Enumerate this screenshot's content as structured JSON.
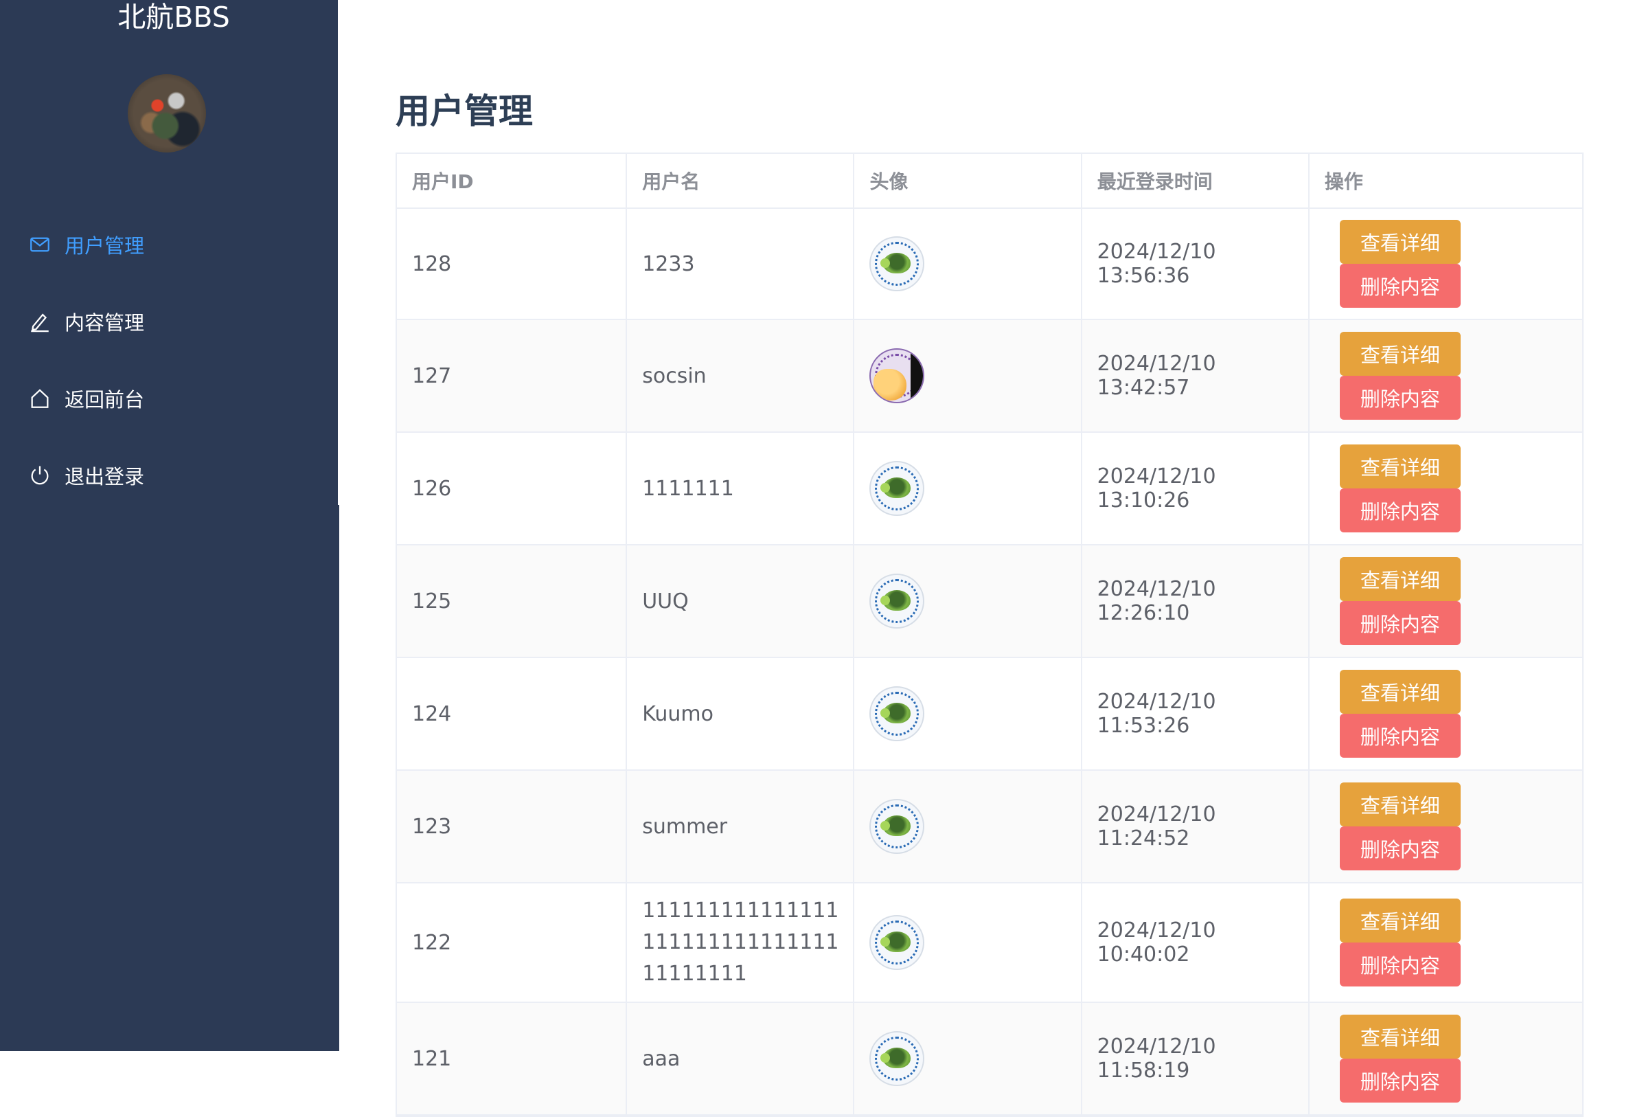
{
  "app": {
    "brand": "北航BBS"
  },
  "sidebar": {
    "items": [
      {
        "label": "用户管理",
        "icon": "mail-icon",
        "active": true
      },
      {
        "label": "内容管理",
        "icon": "edit-icon",
        "active": false
      },
      {
        "label": "返回前台",
        "icon": "home-icon",
        "active": false
      },
      {
        "label": "退出登录",
        "icon": "power-icon",
        "active": false
      }
    ]
  },
  "main": {
    "title": "用户管理",
    "table": {
      "headers": [
        "用户ID",
        "用户名",
        "头像",
        "最近登录时间",
        "操作"
      ],
      "view_label": "查看详细",
      "delete_label": "删除内容",
      "rows": [
        {
          "id": "128",
          "name": "1233",
          "avatar": "turtle-avatar-icon",
          "last_login": "2024/12/10 13:56:36"
        },
        {
          "id": "127",
          "name": "socsin",
          "avatar": "fist-avatar-icon",
          "last_login": "2024/12/10 13:42:57"
        },
        {
          "id": "126",
          "name": "1111111",
          "avatar": "turtle-avatar-icon",
          "last_login": "2024/12/10 13:10:26"
        },
        {
          "id": "125",
          "name": "UUQ",
          "avatar": "turtle-avatar-icon",
          "last_login": "2024/12/10 12:26:10"
        },
        {
          "id": "124",
          "name": "Kuumo",
          "avatar": "turtle-avatar-icon",
          "last_login": "2024/12/10 11:53:26"
        },
        {
          "id": "123",
          "name": "summer",
          "avatar": "turtle-avatar-icon",
          "last_login": "2024/12/10 11:24:52"
        },
        {
          "id": "122",
          "name": "11111111111111111111111111111111111111",
          "avatar": "turtle-avatar-icon",
          "last_login": "2024/12/10 10:40:02"
        },
        {
          "id": "121",
          "name": "aaa",
          "avatar": "turtle-avatar-icon",
          "last_login": "2024/12/10 11:58:19"
        }
      ]
    }
  },
  "colors": {
    "sidebar_bg": "#2c3a55",
    "active_menu": "#409eff",
    "view_button": "#e6a23c",
    "delete_button": "#f56c6c",
    "title": "#2d3e55"
  }
}
